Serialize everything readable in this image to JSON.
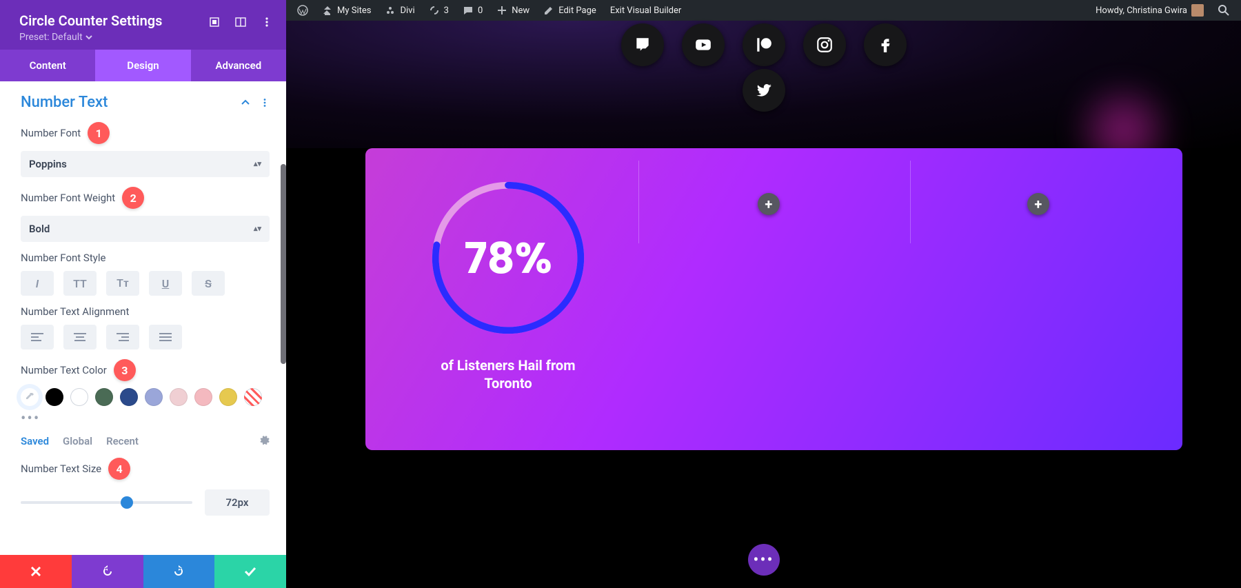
{
  "panel": {
    "title": "Circle Counter Settings",
    "preset": "Preset: Default",
    "tabs": {
      "content": "Content",
      "design": "Design",
      "advanced": "Advanced"
    },
    "section_title": "Number Text",
    "labels": {
      "font": "Number Font",
      "weight": "Number Font Weight",
      "style": "Number Font Style",
      "align": "Number Text Alignment",
      "color": "Number Text Color",
      "size": "Number Text Size"
    },
    "font_value": "Poppins",
    "weight_value": "Bold",
    "style_buttons": [
      "I",
      "TT",
      "Tᴛ",
      "U",
      "S"
    ],
    "color_tabs": {
      "saved": "Saved",
      "global": "Global",
      "recent": "Recent"
    },
    "swatches": [
      "eyedrop",
      "#000000",
      "outline",
      "#4a6b55",
      "#2b4a8b",
      "#9aa6d9",
      "#f0cfd3",
      "#f4b9bf",
      "#e6c94f",
      "stripe"
    ],
    "size_value": "72px",
    "slider_pct": 62,
    "badges": {
      "font": "1",
      "weight": "2",
      "color": "3",
      "size": "4"
    }
  },
  "wpbar": {
    "mysites": "My Sites",
    "divi": "Divi",
    "updates": "3",
    "comments": "0",
    "new": "New",
    "edit": "Edit Page",
    "exit": "Exit Visual Builder",
    "howdy": "Howdy, Christina Gwira"
  },
  "preview": {
    "percent": "78%",
    "caption": "of Listeners Hail from\nToronto"
  }
}
